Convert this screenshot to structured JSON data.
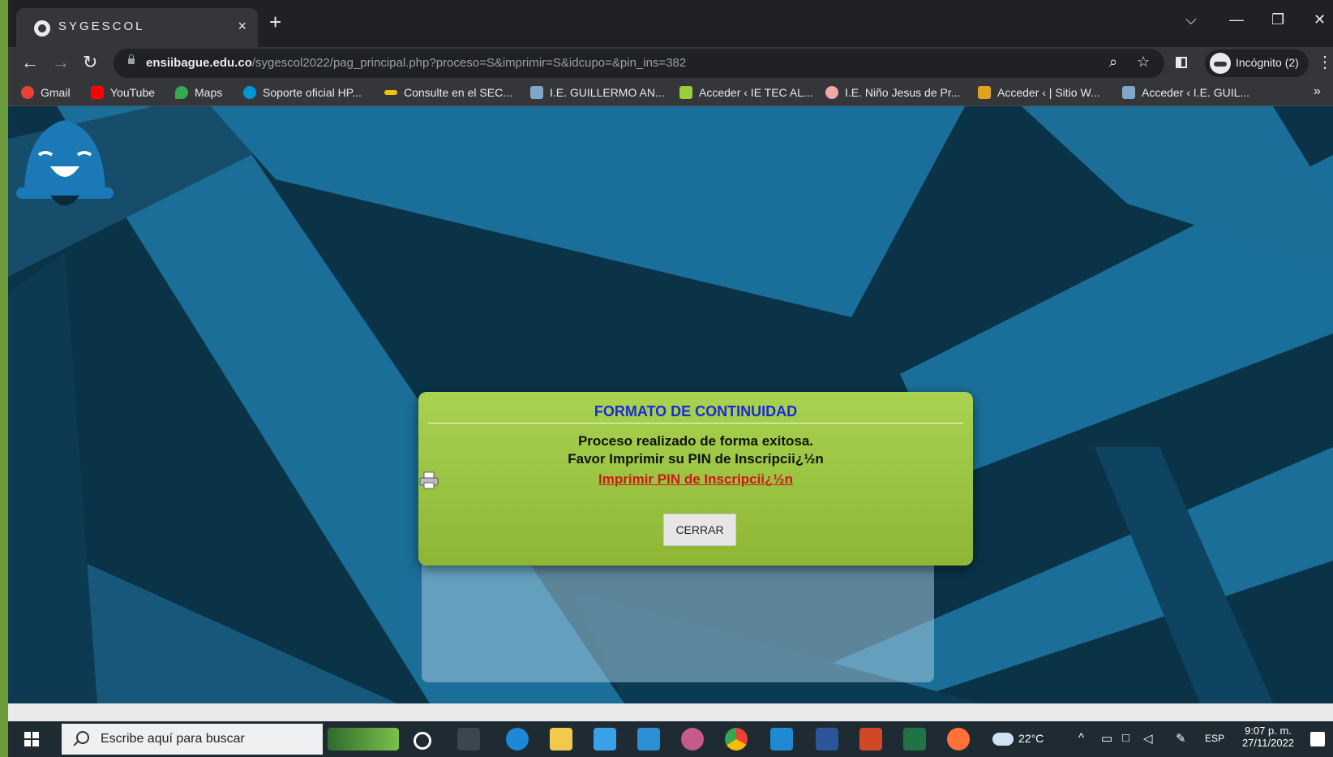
{
  "browser": {
    "tab_title": "SYGESCOL",
    "tab_close": "×",
    "new_tab": "+",
    "window_controls": {
      "dropdown": "⌵",
      "minimize": "—",
      "restore": "❐",
      "close": "✕"
    },
    "url_host": "ensiibague.edu.co",
    "url_path": "/sygescol2022/pag_principal.php?proceso=S&imprimir=S&idcupo=&pin_ins=382",
    "incognito_label": "Incógnito (2)",
    "bookmarks": [
      {
        "label": "Gmail",
        "color": "#ea4335"
      },
      {
        "label": "YouTube",
        "color": "#ff0000"
      },
      {
        "label": "Maps",
        "color": "#34a853"
      },
      {
        "label": "Soporte oficial HP...",
        "color": "#0096d6"
      },
      {
        "label": "Consulte en el SEC...",
        "color": "#f2c200"
      },
      {
        "label": "I.E. GUILLERMO AN...",
        "color": "#7fa7c9"
      },
      {
        "label": "Acceder ‹ IE TEC AL...",
        "color": "#9bcf3a"
      },
      {
        "label": "I.E. Niño Jesus de Pr...",
        "color": "#f4a6a6"
      },
      {
        "label": "Acceder ‹ | Sitio W...",
        "color": "#e0a020"
      },
      {
        "label": "Acceder ‹ I.E. GUIL...",
        "color": "#7fa7c9"
      }
    ],
    "bookmarks_more": "»"
  },
  "dialog": {
    "title": "FORMATO DE CONTINUIDAD",
    "message_line1": "Proceso realizado de forma exitosa.",
    "message_line2": "Favor Imprimir su PIN de Inscripcii¿½n",
    "print_link": " Imprimir PIN de Inscripcii¿½n",
    "close_button": "CERRAR"
  },
  "taskbar": {
    "search_placeholder": "Escribe aquí para buscar",
    "weather": "22°C",
    "language": "ESP",
    "time": "9:07 p. m.",
    "date": "27/11/2022"
  },
  "colors": {
    "dialog_title": "#1a2bd8",
    "print_link": "#d01818",
    "dialog_green": "#9cc843",
    "page_dark": "#0a3348",
    "page_blue": "#1a6f9a"
  }
}
